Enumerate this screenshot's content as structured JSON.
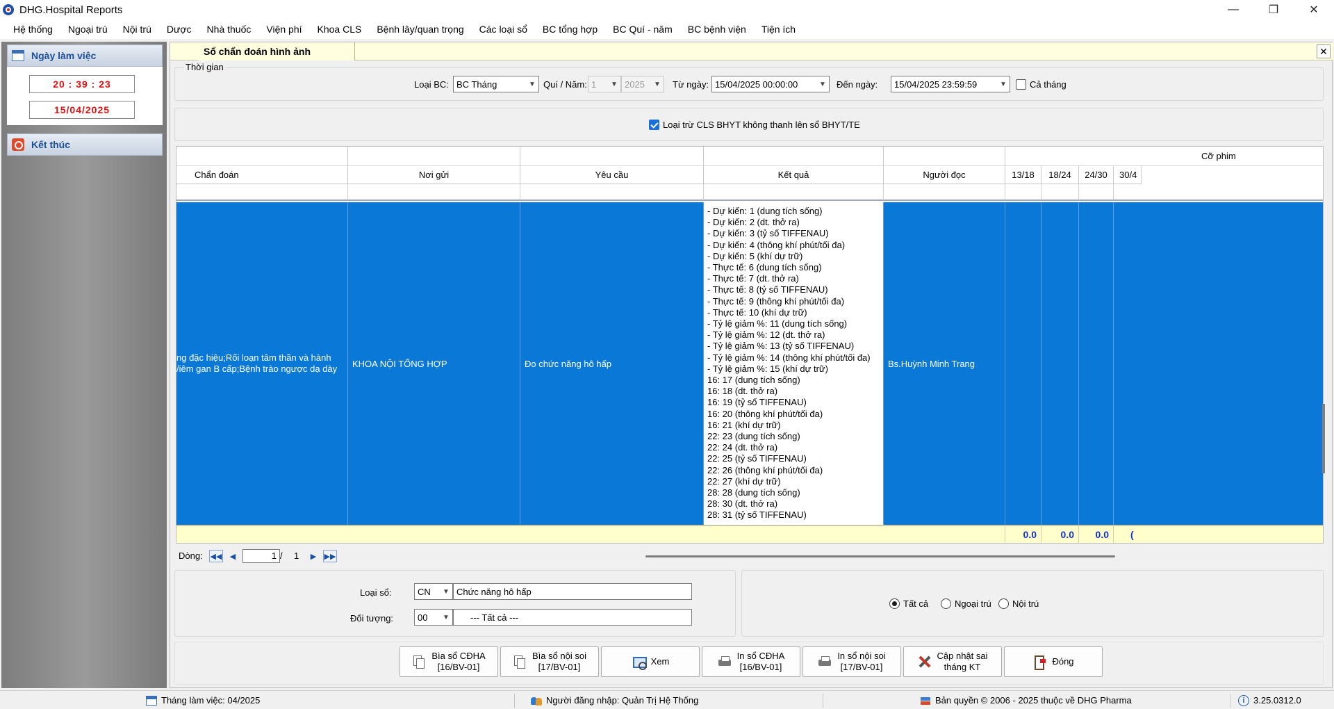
{
  "window": {
    "title": "DHG.Hospital Reports",
    "controls": [
      "—",
      "❐",
      "✕"
    ]
  },
  "menu": [
    "Hệ thống",
    "Ngoại trú",
    "Nội trú",
    "Dược",
    "Nhà thuốc",
    "Viện phí",
    "Khoa CLS",
    "Bệnh lây/quan trọng",
    "Các loại sổ",
    "BC tổng hợp",
    "BC Quí - năm",
    "BC bệnh viện",
    "Tiện ích"
  ],
  "left_panel": {
    "header": "Ngày làm việc",
    "time": "20 : 39 : 23",
    "date": "15/04/2025",
    "exit": "Kết thúc"
  },
  "tab": {
    "title": "Sổ chẩn đoán hình ảnh",
    "close": "✕"
  },
  "time_filter": {
    "group": "Thời gian",
    "loai_bc_label": "Loại BC:",
    "loai_bc_value": "BC Tháng",
    "quy_nam_label": "Quí / Năm:",
    "quy_value": "1",
    "nam_value": "2025",
    "tu_ngay_label": "Từ ngày:",
    "tu_ngay_value": "15/04/2025 00:00:00",
    "den_ngay_label": "Đến ngày:",
    "den_ngay_value": "15/04/2025 23:59:59",
    "ca_thang_label": "Cả tháng",
    "ca_thang_checked": false
  },
  "exclude_option": {
    "label": "Loại trừ CLS BHYT không thanh lên sổ BHYT/TE",
    "checked": true
  },
  "grid": {
    "group_header": "Cỡ phim",
    "columns": [
      "Chẩn đoán",
      "Nơi gửi",
      "Yêu cầu",
      "Kết quả",
      "Người đọc",
      "13/18",
      "18/24",
      "24/30",
      "30/4"
    ],
    "row": {
      "chan_doan_line1": "ng đặc hiệu;Rối loạn tâm thần và hành",
      "chan_doan_line2": "/iêm gan B cấp;Bệnh trào ngược dạ dày",
      "noi_gui": "KHOA NỘI TỔNG HỢP",
      "yeu_cau": "Đo chức năng hô hấp",
      "ket_qua": [
        "- Dự kiến: 1 (dung tích sống)",
        "- Dự kiến: 2 (dt. thở ra)",
        "- Dự kiến: 3 (tỷ số TIFFENAU)",
        "- Dự kiến: 4 (thông khí phút/tối đa)",
        "- Dự kiến: 5 (khí dự trữ)",
        "- Thực tế: 6 (dung tích sống)",
        "- Thực tế: 7 (dt. thở ra)",
        "- Thực tế: 8 (tỷ số TIFFENAU)",
        "- Thực tế: 9 (thông khí phút/tối đa)",
        "- Thực tế: 10 (khí dự trữ)",
        "- Tỷ lệ giảm %: 11 (dung tích sống)",
        "- Tỷ lệ giảm %: 12 (dt. thở ra)",
        "- Tỷ lệ giảm %: 13 (tỷ số TIFFENAU)",
        "- Tỷ lệ giảm %: 14 (thông khí phút/tối đa)",
        "- Tỷ lệ giảm %: 15 (khí dự trữ)",
        "16: 17 (dung tích sống)",
        "16: 18 (dt. thở ra)",
        "16: 19 (tỷ số TIFFENAU)",
        "16: 20 (thông khí phút/tối đa)",
        "16: 21 (khí dự trữ)",
        "22: 23 (dung tích sống)",
        "22: 24 (dt. thở ra)",
        "22: 25 (tỷ số TIFFENAU)",
        "22: 26 (thông khí phút/tối đa)",
        "22: 27 (khí dự trữ)",
        "28: 28 (dung tích sống)",
        "28: 30 (dt. thở ra)",
        "28: 31 (tỷ số TIFFENAU)"
      ],
      "nguoi_doc": "Bs.Huỳnh Minh Trang"
    },
    "totals": [
      "0.0",
      "0.0",
      "0.0",
      "("
    ]
  },
  "navigator": {
    "label": "Dòng:",
    "current": "1",
    "separator": "/",
    "total": "1"
  },
  "bottom_filter": {
    "loai_so_label": "Loại sổ:",
    "loai_so_code": "CN",
    "loai_so_name": "Chức năng hô hấp",
    "doi_tuong_label": "Đối tượng:",
    "doi_tuong_code": "00",
    "doi_tuong_name": "--- Tất cả ---",
    "radios": [
      {
        "label": "Tất cả",
        "checked": true
      },
      {
        "label": "Ngoại trú",
        "checked": false
      },
      {
        "label": "Nội trú",
        "checked": false
      }
    ]
  },
  "buttons": [
    {
      "label": "Bìa sổ CĐHA\n[16/BV-01]",
      "icon": "copy-icon"
    },
    {
      "label": "Bìa sổ nội soi\n[17/BV-01]",
      "icon": "copy-icon"
    },
    {
      "label": "Xem",
      "icon": "view-icon"
    },
    {
      "label": "In sổ CĐHA\n[16/BV-01]",
      "icon": "print-icon"
    },
    {
      "label": "In sổ nội soi\n[17/BV-01]",
      "icon": "print-icon"
    },
    {
      "label": "Cập nhật sai\ntháng KT",
      "icon": "tools-icon"
    },
    {
      "label": "Đóng",
      "icon": "close-door-icon"
    }
  ],
  "statusbar": {
    "thang": "Tháng làm việc: 04/2025",
    "user": "Người đăng nhập: Quản Trị Hệ Thống",
    "copyright": "Bản quyền © 2006 - 2025 thuộc về DHG Pharma",
    "version": "3.25.0312.0"
  }
}
